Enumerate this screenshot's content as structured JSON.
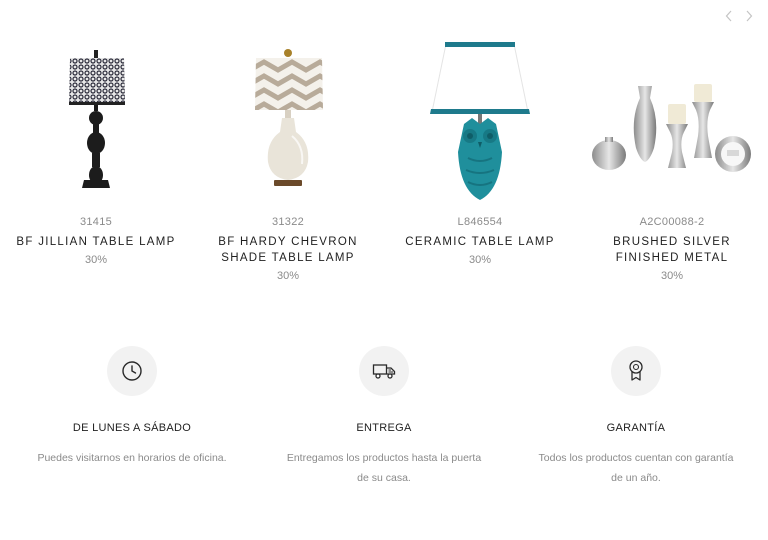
{
  "carousel": {
    "prev_icon": "chevron-left-icon",
    "next_icon": "chevron-right-icon"
  },
  "products": [
    {
      "sku": "31415",
      "name": "BF JILLIAN TABLE LAMP",
      "discount": "30%",
      "image": "black-lamp-image"
    },
    {
      "sku": "31322",
      "name": "BF HARDY CHEVRON SHADE TABLE LAMP",
      "discount": "30%",
      "image": "chevron-lamp-image"
    },
    {
      "sku": "L846554",
      "name": "CERAMIC TABLE LAMP",
      "discount": "30%",
      "image": "owl-lamp-image"
    },
    {
      "sku": "A2C00088-2",
      "name": "BRUSHED SILVER FINISHED METAL",
      "discount": "30%",
      "image": "silver-decor-image"
    }
  ],
  "features": [
    {
      "title": "DE LUNES A SÁBADO",
      "description": "Puedes visitarnos en horarios de oficina.",
      "icon": "clock-icon"
    },
    {
      "title": "ENTREGA",
      "description": "Entregamos los productos hasta la puerta de su casa.",
      "icon": "truck-icon"
    },
    {
      "title": "GARANTÍA",
      "description": "Todos los productos cuentan con garantía de un año.",
      "icon": "award-ribbon-icon"
    }
  ],
  "colors": {
    "accent_teal": "#1e7a8c",
    "muted_text": "#8a8a8a",
    "icon_bg": "#f2f2f2"
  }
}
